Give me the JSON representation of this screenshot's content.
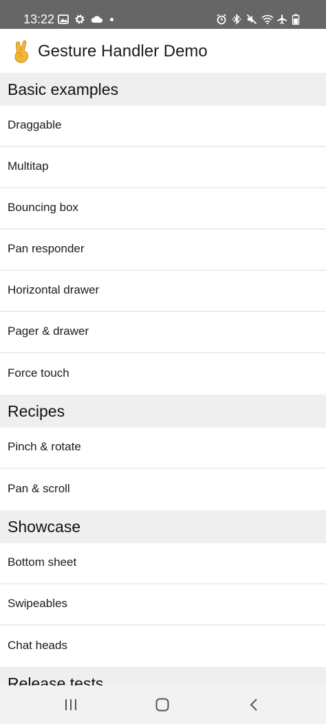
{
  "status_bar": {
    "time": "13:22",
    "left_icons": [
      "image-icon",
      "gear-icon",
      "cloud-icon",
      "notification-dot"
    ],
    "right_icons": [
      "alarm-icon",
      "bluetooth-icon",
      "mute-icon",
      "wifi-icon",
      "airplane-icon",
      "battery-icon"
    ]
  },
  "header": {
    "emoji": "victory-hand-emoji",
    "title": "Gesture Handler Demo"
  },
  "sections": [
    {
      "title": "Basic examples",
      "items": [
        "Draggable",
        "Multitap",
        "Bouncing box",
        "Pan responder",
        "Horizontal drawer",
        "Pager & drawer",
        "Force touch"
      ]
    },
    {
      "title": "Recipes",
      "items": [
        "Pinch & rotate",
        "Pan & scroll"
      ]
    },
    {
      "title": "Showcase",
      "items": [
        "Bottom sheet",
        "Swipeables",
        "Chat heads"
      ]
    },
    {
      "title": "Release tests",
      "items": []
    }
  ],
  "nav_bar": {
    "buttons": [
      "recents-icon",
      "home-icon",
      "back-icon"
    ]
  },
  "colors": {
    "status_bar_bg": "#666666",
    "section_bg": "#efefef",
    "divider": "#ededed",
    "nav_bar_bg": "#f2f2f2"
  }
}
